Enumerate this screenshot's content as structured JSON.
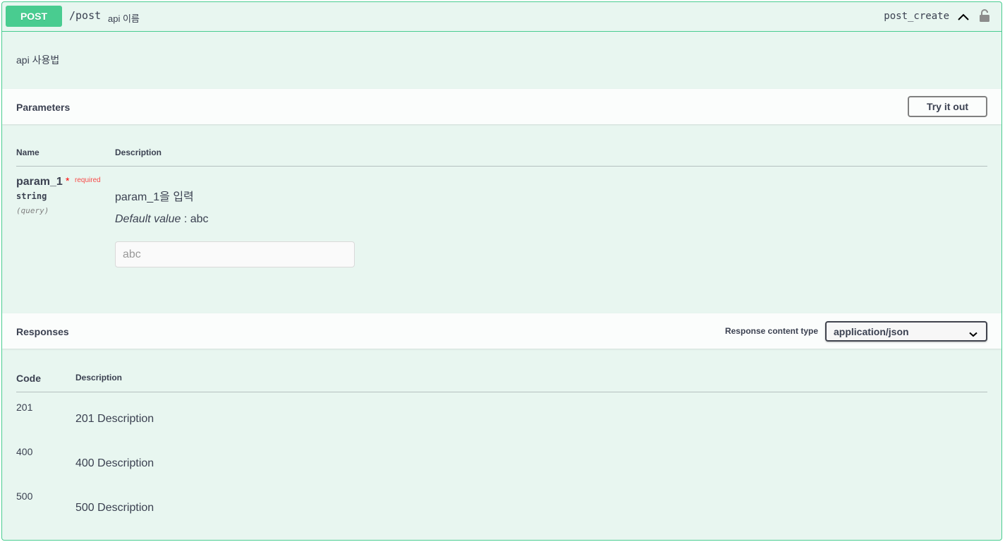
{
  "summary": {
    "method": "POST",
    "path": "/post",
    "description": "api 이름",
    "operation_id": "post_create"
  },
  "description": "api 사용법",
  "parameters": {
    "title": "Parameters",
    "try_button": "Try it out",
    "columns": {
      "name": "Name",
      "description": "Description"
    },
    "items": [
      {
        "name": "param_1",
        "required_star": "*",
        "required_label": "required",
        "type": "string",
        "in": "(query)",
        "description": "param_1을 입력",
        "default_label": "Default value",
        "default_sep": " : ",
        "default_value": "abc",
        "placeholder": "abc"
      }
    ]
  },
  "responses": {
    "title": "Responses",
    "content_type_label": "Response content type",
    "content_type_value": "application/json",
    "columns": {
      "code": "Code",
      "description": "Description"
    },
    "items": [
      {
        "code": "201",
        "description": "201 Description"
      },
      {
        "code": "400",
        "description": "400 Description"
      },
      {
        "code": "500",
        "description": "500 Description"
      }
    ]
  },
  "colors": {
    "post_green": "#49cc90",
    "post_bg": "#e8f6f0",
    "text": "#3b4151",
    "required": "#ff0000"
  },
  "icons": {
    "collapse": "chevron-up-icon",
    "auth": "lock-icon",
    "select": "chevron-down-icon"
  }
}
